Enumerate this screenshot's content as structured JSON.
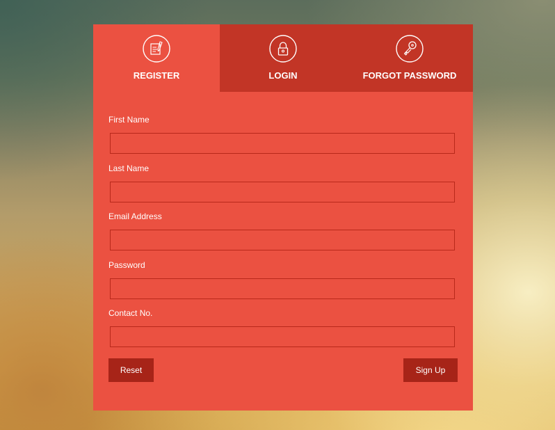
{
  "tabs": [
    {
      "label": "REGISTER",
      "icon": "register-form-icon",
      "active": true
    },
    {
      "label": "LOGIN",
      "icon": "padlock-icon",
      "active": false
    },
    {
      "label": "FORGOT PASSWORD",
      "icon": "key-icon",
      "active": false
    }
  ],
  "form": {
    "fields": [
      {
        "label": "First Name",
        "value": "",
        "placeholder": ""
      },
      {
        "label": "Last Name",
        "value": "",
        "placeholder": ""
      },
      {
        "label": "Email Address",
        "value": "",
        "placeholder": ""
      },
      {
        "label": "Password",
        "value": "",
        "placeholder": ""
      },
      {
        "label": "Contact No.",
        "value": "",
        "placeholder": ""
      }
    ],
    "reset_label": "Reset",
    "signup_label": "Sign Up"
  },
  "colors": {
    "panel": "#eb5141",
    "inactive_tab": "#c23526",
    "button": "#a72418",
    "input_border": "#b8281a"
  }
}
